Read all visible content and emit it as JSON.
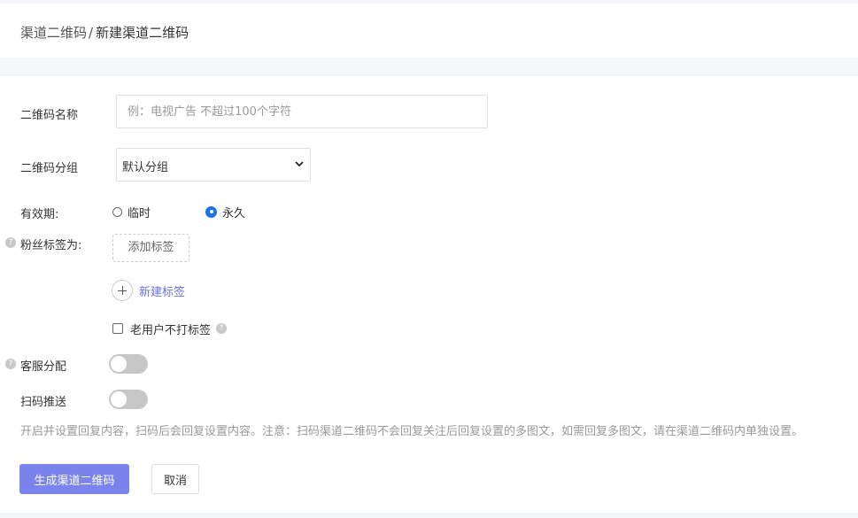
{
  "breadcrumb": {
    "parent": "渠道二维码",
    "separator": "/",
    "current": "新建渠道二维码"
  },
  "form": {
    "name_label": "二维码名称",
    "name_placeholder": "例：电视广告 不超过100个字符",
    "name_value": "",
    "group_label": "二维码分组",
    "group_selected": "默认分组",
    "validity_label": "有效期:",
    "validity_options": [
      "临时",
      "永久"
    ],
    "validity_selected": "永久",
    "fan_tag_label": "粉丝标签为:",
    "add_tag_label": "添加标签",
    "new_tag_label": "新建标签",
    "old_user_no_tag_label": "老用户不打标签",
    "old_user_no_tag_checked": false,
    "service_assign_label": "客服分配",
    "service_assign_on": false,
    "scan_push_label": "扫码推送",
    "scan_push_on": false,
    "scan_push_note": "开启并设置回复内容，扫码后会回复设置内容。注意：扫码渠道二维码不会回复关注后回复设置的多图文，如需回复多图文，请在渠道二维码内单独设置。",
    "help_glyph": "?"
  },
  "actions": {
    "submit_label": "生成渠道二维码",
    "cancel_label": "取消"
  },
  "colors": {
    "primary": "#7b83ec",
    "link": "#6872e0",
    "radio_checked": "#1a73e8",
    "switch_off": "#c7c7c7",
    "page_bg": "#f5f6f9"
  }
}
